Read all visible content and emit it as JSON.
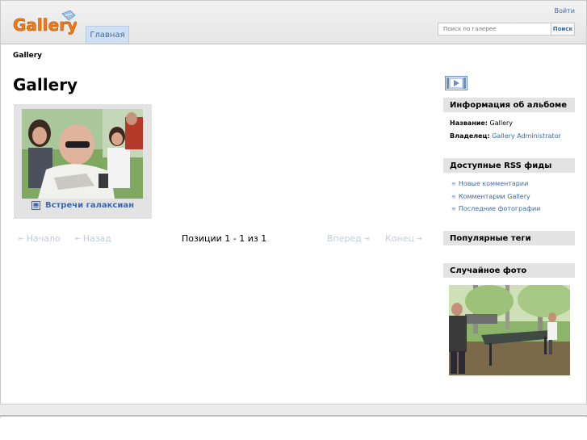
{
  "header": {
    "logo_text": "Gallery",
    "login_label": "Войти",
    "nav_home": "Главная",
    "search_placeholder": "Поиск по галерее",
    "search_button": "Поиск"
  },
  "breadcrumb": "Gallery",
  "page_title": "Gallery",
  "album": {
    "title": "Встречи галаксиан"
  },
  "pager": {
    "first": "Начало",
    "prev": "Назад",
    "position": "Позиции 1 - 1 из 1",
    "next": "Вперед",
    "last": "Конец"
  },
  "sidebar": {
    "album_info": {
      "heading": "Информация об альбоме",
      "name_label": "Название:",
      "name_value": "Gallery",
      "owner_label": "Владелец:",
      "owner_value": "Gallery Administrator"
    },
    "rss": {
      "heading": "Доступные RSS фиды",
      "items": [
        "Новые комментарии",
        "Комментарии Gallery",
        "Последние фотографии"
      ]
    },
    "popular_tags": {
      "heading": "Популярные теги"
    },
    "random_photo": {
      "heading": "Случайное фото"
    }
  },
  "colors": {
    "link": "#3c6aa8",
    "tab_bg": "#cfe0f3",
    "sidebar_head_bg": "#e3e3e3",
    "logo_orange": "#f07a14"
  }
}
